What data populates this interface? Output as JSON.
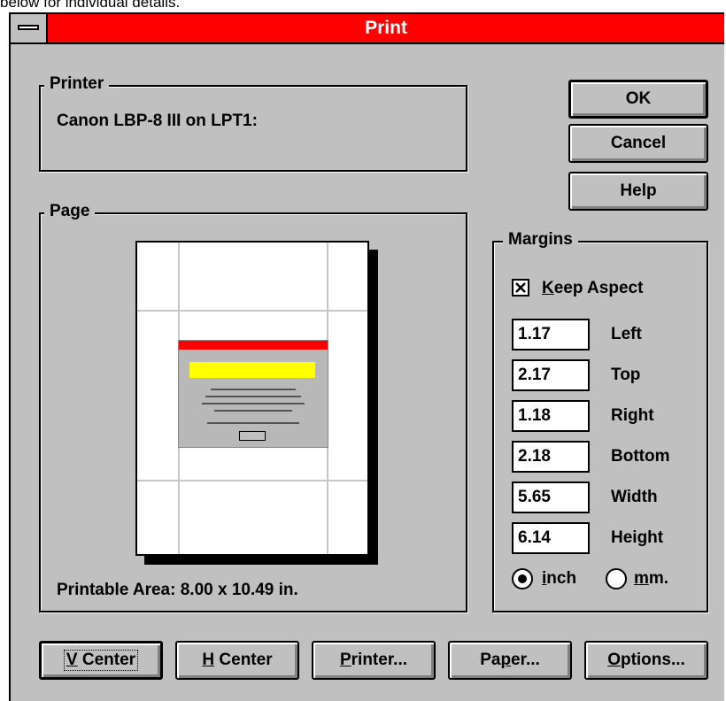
{
  "top_strip_text": "below for individual details.",
  "window": {
    "title": "Print"
  },
  "printer": {
    "group_label": "Printer",
    "name": "Canon LBP-8 III on LPT1:"
  },
  "page": {
    "group_label": "Page",
    "printable_area": "Printable Area: 8.00 x 10.49 in."
  },
  "buttons": {
    "ok": "OK",
    "cancel": "Cancel",
    "help": "Help"
  },
  "margins": {
    "group_label": "Margins",
    "keep_aspect": {
      "label": "Keep Aspect",
      "checked": true
    },
    "fields": [
      {
        "value": "1.17",
        "label": "Left"
      },
      {
        "value": "2.17",
        "label": "Top"
      },
      {
        "value": "1.18",
        "label": "Right"
      },
      {
        "value": "2.18",
        "label": "Bottom"
      },
      {
        "value": "5.65",
        "label": "Width"
      },
      {
        "value": "6.14",
        "label": "Height"
      }
    ],
    "units": [
      {
        "label": "inch",
        "selected": true
      },
      {
        "label": "mm.",
        "selected": false
      }
    ]
  },
  "bottom_buttons": [
    {
      "label": "V Center",
      "default": true
    },
    {
      "label": "H Center",
      "default": false
    },
    {
      "label": "Printer...",
      "default": false
    },
    {
      "label": "Paper...",
      "default": false
    },
    {
      "label": "Options...",
      "default": false
    }
  ],
  "colors": {
    "title_bar": "#ff0000",
    "dialog_bg": "#c0c0c0"
  }
}
